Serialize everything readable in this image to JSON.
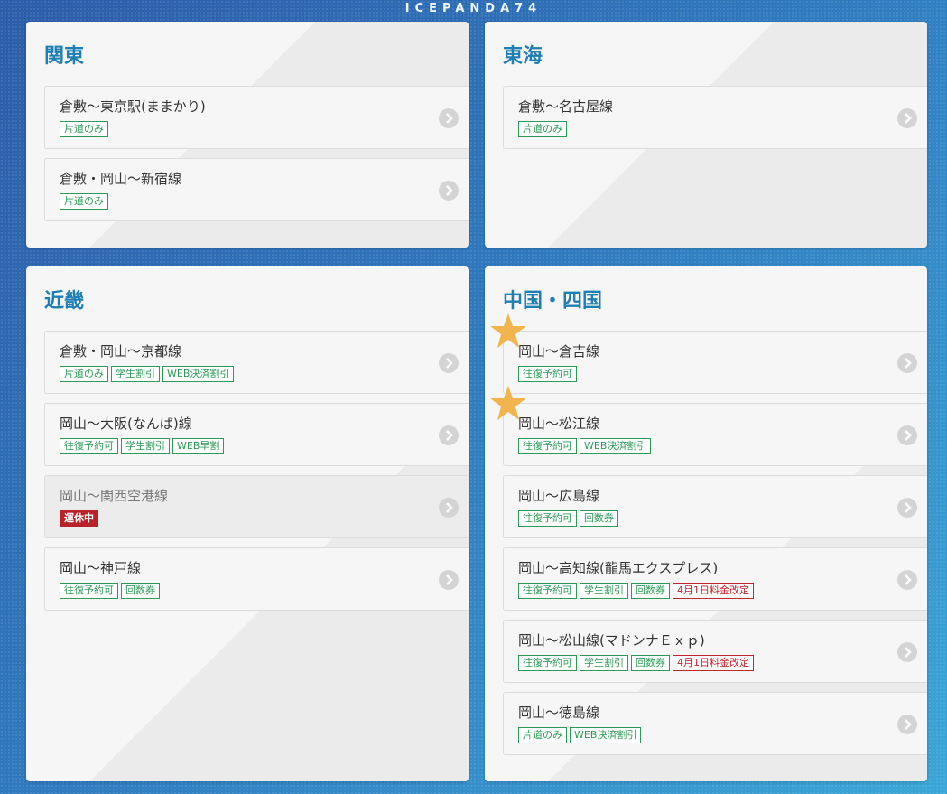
{
  "brand": "ICEPANDA74",
  "colors": {
    "accent": "#1f7fb3",
    "tag_green": "#2e9a5a",
    "tag_red": "#c0262d",
    "star": "#f2b44f"
  },
  "panels": [
    {
      "title": "関東",
      "routes": [
        {
          "name": "倉敷〜東京駅(ままかり)",
          "tags": [
            {
              "label": "片道のみ"
            }
          ]
        },
        {
          "name": "倉敷・岡山〜新宿線",
          "tags": [
            {
              "label": "片道のみ"
            }
          ]
        }
      ]
    },
    {
      "title": "東海",
      "routes": [
        {
          "name": "倉敷〜名古屋線",
          "tags": [
            {
              "label": "片道のみ"
            }
          ]
        }
      ]
    },
    {
      "title": "近畿",
      "routes": [
        {
          "name": "倉敷・岡山〜京都線",
          "tags": [
            {
              "label": "片道のみ"
            },
            {
              "label": "学生割引"
            },
            {
              "label": "WEB決済割引"
            }
          ]
        },
        {
          "name": "岡山〜大阪(なんば)線",
          "tags": [
            {
              "label": "往復予約可"
            },
            {
              "label": "学生割引"
            },
            {
              "label": "WEB早割"
            }
          ]
        },
        {
          "name": "岡山〜関西空港線",
          "tags": [
            {
              "label": "運休中"
            }
          ]
        },
        {
          "name": "岡山〜神戸線",
          "tags": [
            {
              "label": "往復予約可"
            },
            {
              "label": "回数券"
            }
          ]
        }
      ]
    },
    {
      "title": "中国・四国",
      "routes": [
        {
          "name": "岡山〜倉吉線",
          "tags": [
            {
              "label": "往復予約可"
            }
          ]
        },
        {
          "name": "岡山〜松江線",
          "tags": [
            {
              "label": "往復予約可"
            },
            {
              "label": "WEB決済割引"
            }
          ]
        },
        {
          "name": "岡山〜広島線",
          "tags": [
            {
              "label": "往復予約可"
            },
            {
              "label": "回数券"
            }
          ]
        },
        {
          "name": "岡山〜高知線(龍馬エクスプレス)",
          "tags": [
            {
              "label": "往復予約可"
            },
            {
              "label": "学生割引"
            },
            {
              "label": "回数券"
            },
            {
              "label": "4月1日料金改定"
            }
          ]
        },
        {
          "name": "岡山〜松山線(マドンナＥｘｐ)",
          "tags": [
            {
              "label": "往復予約可"
            },
            {
              "label": "学生割引"
            },
            {
              "label": "回数券"
            },
            {
              "label": "4月1日料金改定"
            }
          ]
        },
        {
          "name": "岡山〜徳島線",
          "tags": [
            {
              "label": "片道のみ"
            },
            {
              "label": "WEB決済割引"
            }
          ]
        }
      ]
    }
  ]
}
